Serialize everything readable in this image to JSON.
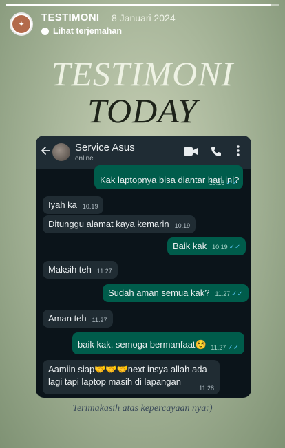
{
  "story": {
    "account_name": "TESTIMONI",
    "date": "8 Januari 2024",
    "translate_label": "Lihat terjemahan",
    "progress": 0.97
  },
  "title": {
    "line1": "TESTIMONI",
    "line2": "TODAY"
  },
  "chat": {
    "contact_name": "Service Asus",
    "contact_status": "online",
    "messages": [
      {
        "dir": "out",
        "text": "Kak laptopnya bisa diantar hari ini?",
        "time": "10.18",
        "read": true
      },
      {
        "dir": "in",
        "text": "Iyah ka",
        "time": "10.19"
      },
      {
        "dir": "in",
        "text": "Ditunggu alamat kaya kemarin",
        "time": "10.19"
      },
      {
        "dir": "out",
        "text": "Baik kak",
        "time": "10.19",
        "read": true
      },
      {
        "dir": "in",
        "text": "Maksih teh",
        "time": "11.27"
      },
      {
        "dir": "out",
        "text": "Sudah aman semua kak?",
        "time": "11.27",
        "read": true
      },
      {
        "dir": "in",
        "text": "Aman teh",
        "time": "11.27"
      },
      {
        "dir": "out",
        "text": "baik kak, semoga bermanfaat☺️",
        "time": "11.27",
        "read": true
      },
      {
        "dir": "in",
        "line1": "Aamiin siap🤝🤝🤝next insya allah ada",
        "line2": "lagi tapi laptop masih di lapangan",
        "time": "11.28"
      }
    ],
    "read_tick": "✓✓"
  },
  "footer": "Terimakasih atas kepercayaan nya:)",
  "colors": {
    "outgoing": "#005c4b",
    "incoming": "#202c33",
    "header": "#1f2c34",
    "chat_bg": "#0b141a"
  }
}
